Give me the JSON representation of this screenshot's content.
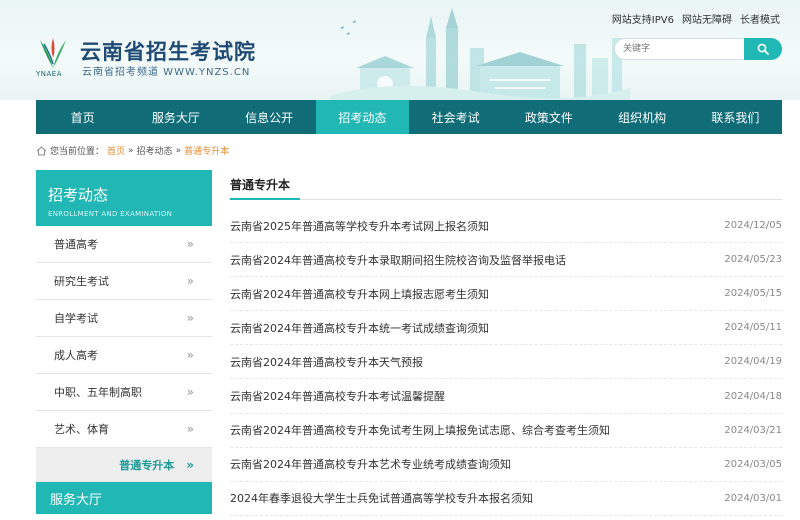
{
  "header": {
    "site_title": "云南省招生考试院",
    "site_subtitle": "云南省招考频道 WWW.YNZS.CN",
    "logo_text": "YNAEA",
    "top_links": [
      "网站支持IPV6",
      "网站无障碍",
      "长者模式"
    ],
    "search_placeholder": "关键字"
  },
  "nav": {
    "items": [
      "首页",
      "服务大厅",
      "信息公开",
      "招考动态",
      "社会考试",
      "政策文件",
      "组织机构",
      "联系我们"
    ],
    "active_index": 3
  },
  "breadcrumb": {
    "label": "您当前位置：",
    "home": "首页",
    "sep": "»",
    "section": "招考动态",
    "current": "普通专升本"
  },
  "sidebar": {
    "title": "招考动态",
    "title_en": "ENROLLMENT AND EXAMINATION",
    "items": [
      "普通高考",
      "研究生考试",
      "自学考试",
      "成人高考",
      "中职、五年制高职",
      "艺术、体育"
    ],
    "active_item": "普通专升本",
    "arrow": "»",
    "footer": "服务大厅"
  },
  "main": {
    "title": "普通专升本",
    "articles": [
      {
        "title": "云南省2025年普通高等学校专升本考试网上报名须知",
        "date": "2024/12/05"
      },
      {
        "title": "云南省2024年普通高校专升本录取期间招生院校咨询及监督举报电话",
        "date": "2024/05/23"
      },
      {
        "title": "云南省2024年普通高校专升本网上填报志愿考生须知",
        "date": "2024/05/15"
      },
      {
        "title": "云南省2024年普通高校专升本统一考试成绩查询须知",
        "date": "2024/05/11"
      },
      {
        "title": "云南省2024年普通高校专升本天气预报",
        "date": "2024/04/19"
      },
      {
        "title": "云南省2024年普通高校专升本考试温馨提醒",
        "date": "2024/04/18"
      },
      {
        "title": "云南省2024年普通高校专升本免试考生网上填报免试志愿、综合考查考生须知",
        "date": "2024/03/21"
      },
      {
        "title": "云南省2024年普通高校专升本艺术专业统考成绩查询须知",
        "date": "2024/03/05"
      },
      {
        "title": "2024年春季退役大学生士兵免试普通高等学校专升本报名须知",
        "date": "2024/03/01"
      }
    ]
  },
  "colors": {
    "nav_bg": "#106d78",
    "accent": "#21b7b5",
    "breadcrumb_link": "#e78a2b",
    "title_blue": "#1f4a73"
  }
}
